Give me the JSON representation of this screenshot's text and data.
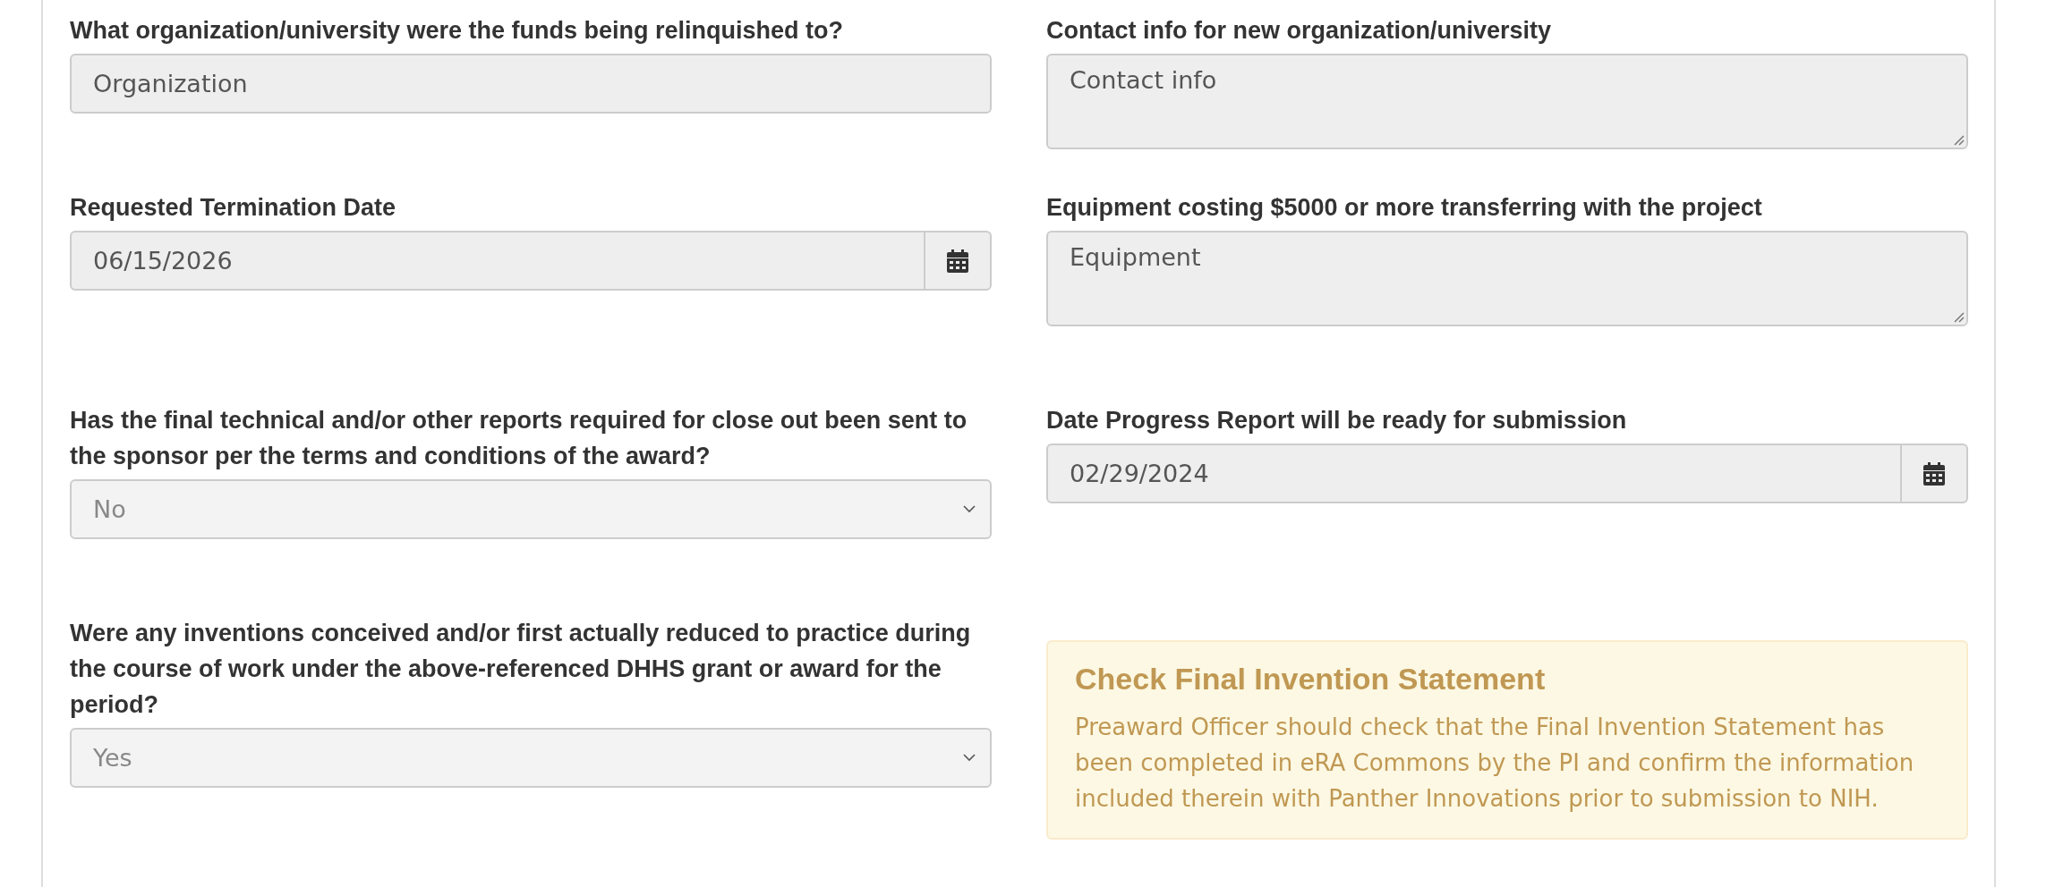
{
  "fields": [
    {
      "kind": "text",
      "label": "What organization/university were the funds being relinquished to?",
      "value": "Organization"
    },
    {
      "kind": "textarea",
      "label": "Contact info for new organization/university",
      "value": "Contact info"
    },
    {
      "kind": "date",
      "label": "Requested Termination Date",
      "value": "06/15/2026"
    },
    {
      "kind": "textarea",
      "label": "Equipment costing $5000 or more transferring with the project",
      "value": "Equipment"
    },
    {
      "kind": "select",
      "label": "Has the final technical and/or other reports required for close out been sent to the sponsor per the terms and conditions of the award?",
      "value": "No"
    },
    {
      "kind": "date",
      "label": "Date Progress Report will be ready for submission",
      "value": "02/29/2024"
    },
    {
      "kind": "select",
      "label": "Were any inventions conceived and/or first actually reduced to practice during the course of work under the above-referenced DHHS grant or award for the period?",
      "value": "Yes"
    },
    {
      "kind": "alert",
      "title": "Check Final Invention Statement",
      "text": "Preaward Officer should check that the Final Invention Statement has been completed in eRA Commons by the PI and confirm the information included therein with Panther Innovations prior to submission to NIH."
    }
  ]
}
